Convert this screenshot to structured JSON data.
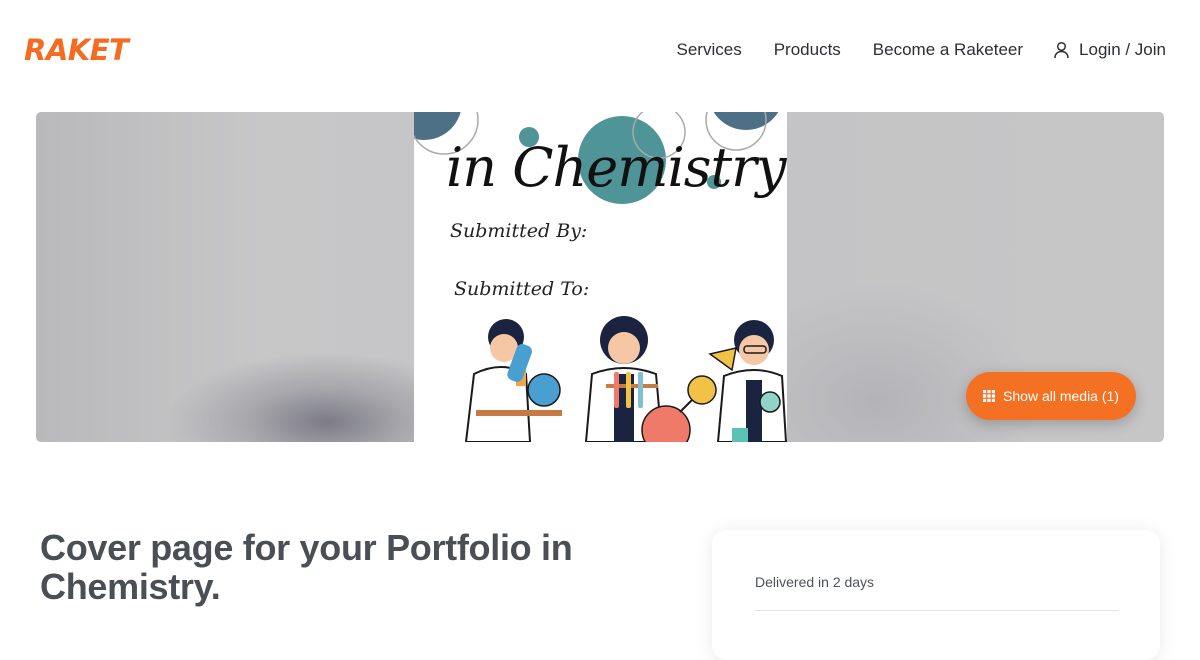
{
  "brand": {
    "logo_text": "RAKET",
    "accent_color": "#f36c21"
  },
  "nav": {
    "items": [
      "Services",
      "Products",
      "Become a Raketeer"
    ],
    "login_label": "Login / Join",
    "login_icon": "user-icon"
  },
  "media": {
    "cover_title": "in Chemistry",
    "submitted_by": "Submitted By:",
    "submitted_to": "Submitted To:",
    "show_all_label": "Show all media (1)",
    "show_all_icon": "grid-icon"
  },
  "listing": {
    "title": "Cover page for your Portfolio in Chemistry.",
    "delivery": "Delivered in 2 days"
  }
}
